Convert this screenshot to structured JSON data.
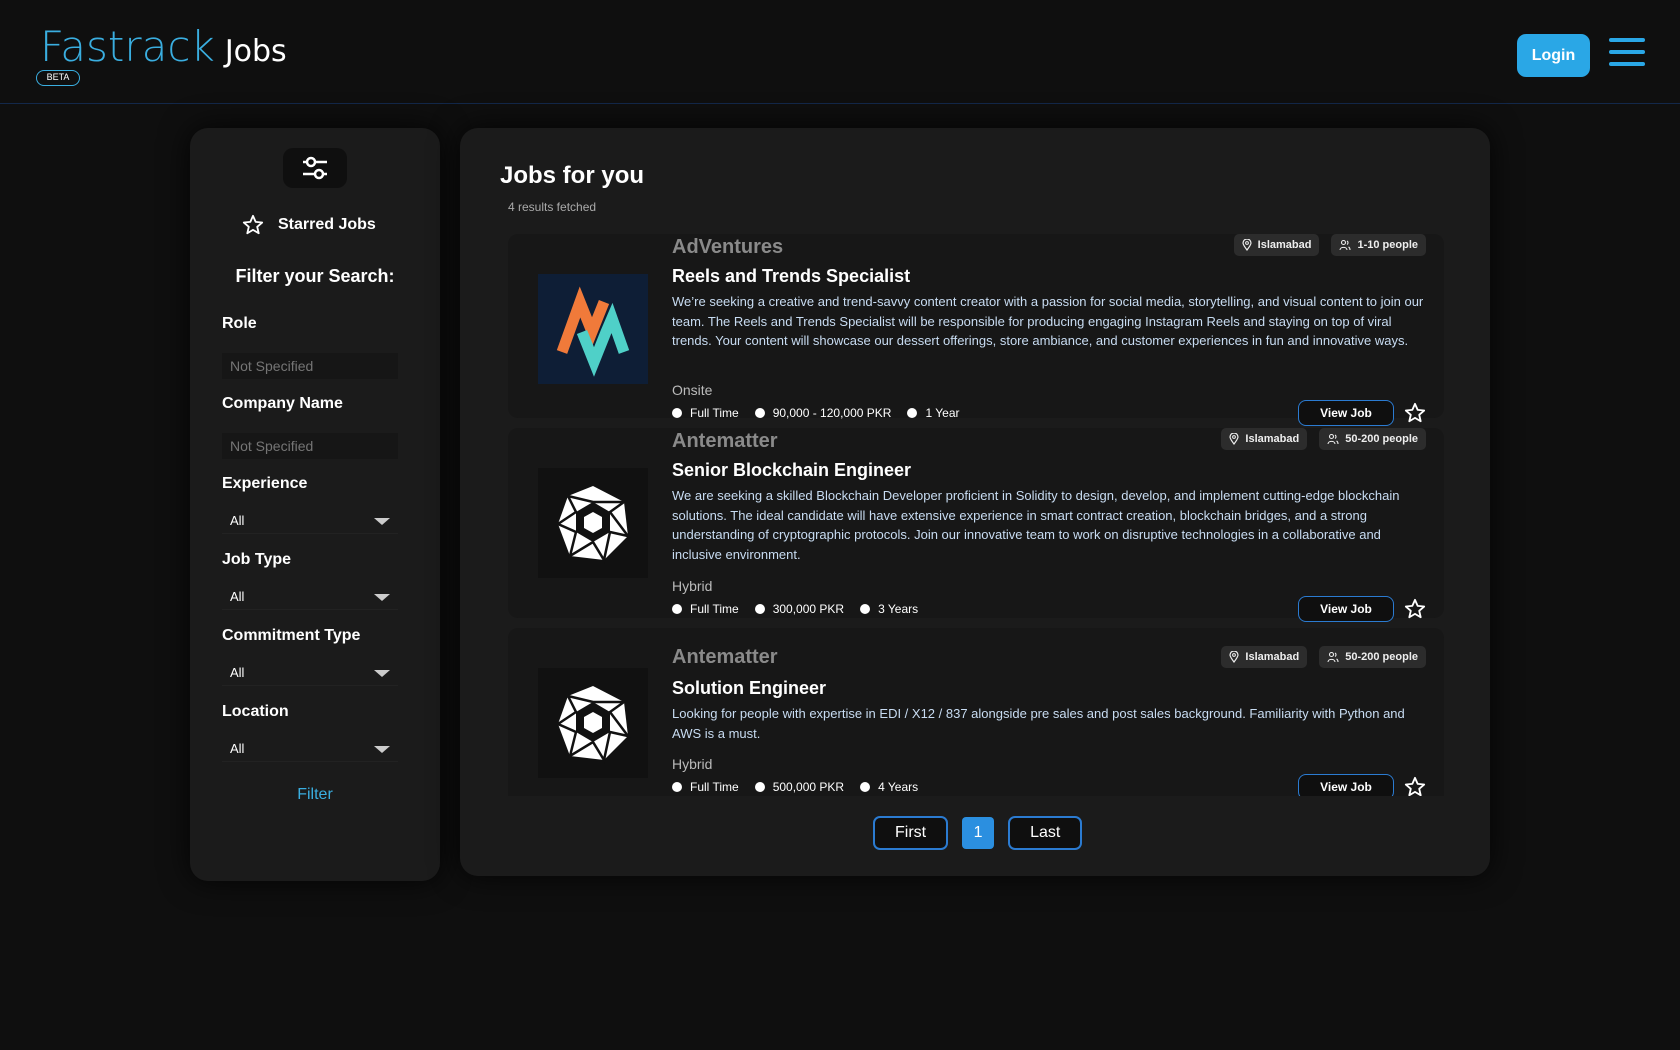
{
  "header": {
    "logo_main": "Fastrack",
    "logo_sub": "Jobs",
    "beta": "BETA",
    "login_label": "Login",
    "accent_color": "#2aa7e6"
  },
  "sidebar": {
    "starred_label": "Starred Jobs",
    "filter_title": "Filter your Search:",
    "role": {
      "label": "Role",
      "placeholder": "Not Specified"
    },
    "company": {
      "label": "Company Name",
      "placeholder": "Not Specified"
    },
    "experience": {
      "label": "Experience",
      "value": "All"
    },
    "job_type": {
      "label": "Job Type",
      "value": "All"
    },
    "commitment": {
      "label": "Commitment Type",
      "value": "All"
    },
    "location": {
      "label": "Location",
      "value": "All"
    },
    "filter_button": "Filter"
  },
  "main": {
    "title": "Jobs for you",
    "results": "4 results fetched",
    "view_label": "View Job",
    "jobs": [
      {
        "company": "AdVentures",
        "location": "Islamabad",
        "size": "1-10 people",
        "title": "Reels and Trends Specialist",
        "description": "We’re seeking a creative and trend-savvy content creator with a passion for social media, storytelling, and visual content to join our team. The Reels and Trends Specialist will be responsible for producing engaging Instagram Reels and staying on top of viral trends. Your content will showcase our dessert offerings, store ambiance, and customer experiences in fun and innovative ways.",
        "mode": "Onsite",
        "type": "Full Time",
        "salary": "90,000 - 120,000 PKR",
        "experience": "1 Year",
        "logo": "adventures-logo"
      },
      {
        "company": "Antematter",
        "location": "Islamabad",
        "size": "50-200 people",
        "title": "Senior Blockchain Engineer",
        "description": "We are seeking a skilled Blockchain Developer proficient in Solidity to design, develop, and implement cutting-edge blockchain solutions. The ideal candidate will have extensive experience in smart contract creation, blockchain bridges, and a strong understanding of cryptographic protocols. Join our innovative team to work on disruptive technologies in a collaborative and inclusive environment.",
        "mode": "Hybrid",
        "type": "Full Time",
        "salary": "300,000 PKR",
        "experience": "3 Years",
        "logo": "antematter-logo"
      },
      {
        "company": "Antematter",
        "location": "Islamabad",
        "size": "50-200 people",
        "title": "Solution Engineer",
        "description": "Looking for people with expertise in EDI / X12 / 837 alongside pre sales and post sales background. Familiarity with Python and AWS is a must.",
        "mode": "Hybrid",
        "type": "Full Time",
        "salary": "500,000 PKR",
        "experience": "4 Years",
        "logo": "antematter-logo"
      }
    ]
  },
  "pagination": {
    "first": "First",
    "current": "1",
    "last": "Last"
  }
}
